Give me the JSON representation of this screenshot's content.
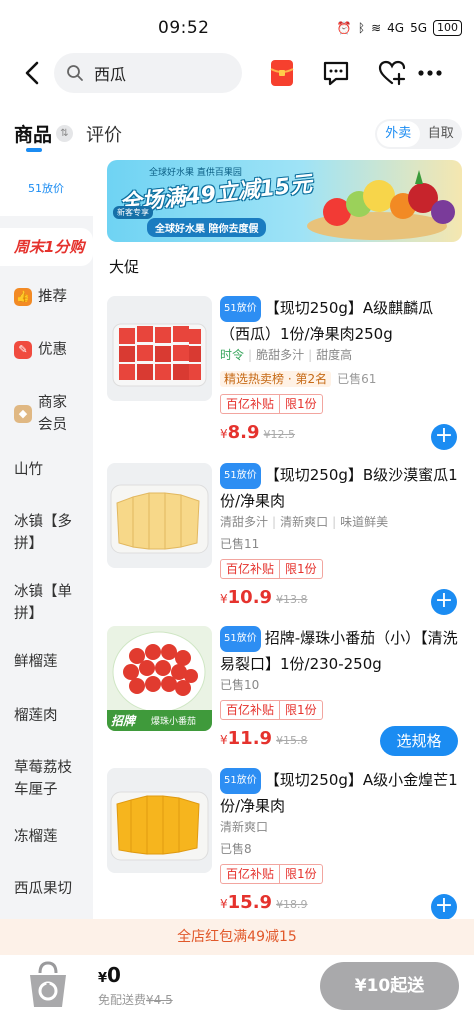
{
  "status_bar": {
    "time": "09:52",
    "signal1": "4G",
    "signal2": "5G",
    "battery": "100"
  },
  "search": {
    "query": "西瓜"
  },
  "tabs": {
    "goods": "商品",
    "review": "评价",
    "delivery": "外卖",
    "pickup": "自取"
  },
  "sidebar": {
    "items": [
      {
        "label": "51放价"
      },
      {
        "label": "周末1分购"
      },
      {
        "label": "推荐"
      },
      {
        "label": "优惠"
      },
      {
        "label": "商家会员"
      },
      {
        "label": "山竹"
      },
      {
        "label": "冰镇【多拼】"
      },
      {
        "label": "冰镇【单拼】"
      },
      {
        "label": "鲜榴莲"
      },
      {
        "label": "榴莲肉"
      },
      {
        "label": "草莓荔枝车厘子"
      },
      {
        "label": "冻榴莲"
      },
      {
        "label": "西瓜果切"
      }
    ]
  },
  "banner": {
    "top_line": "全球好水果 直供百果园",
    "headline": "全场满49立减15元",
    "tag": "新客专享",
    "slogan": "全球好水果 陪你去度假"
  },
  "section_title": "大促",
  "badge": "51放价",
  "products": [
    {
      "name": "【现切250g】A级麒麟瓜（西瓜）1份/净果肉250g",
      "tags": [
        "时令",
        "脆甜多汁",
        "甜度高"
      ],
      "rank": "精选热卖榜 · 第2名",
      "sold": "已售61",
      "chip1": "百亿补贴",
      "chip2": "限1份",
      "yen": "¥",
      "price": "8.9",
      "original": "¥12.5",
      "action": "+"
    },
    {
      "name": "【现切250g】B级沙漠蜜瓜1份/净果肉",
      "tags": [
        "清甜多汁",
        "清新爽口",
        "味道鲜美"
      ],
      "sold": "已售11",
      "chip1": "百亿补贴",
      "chip2": "限1份",
      "yen": "¥",
      "price": "10.9",
      "original": "¥13.8",
      "action": "+"
    },
    {
      "name": "招牌-爆珠小番茄（小）【清洗易裂口】1份/230-250g",
      "sold": "已售10",
      "chip1": "百亿补贴",
      "chip2": "限1份",
      "yen": "¥",
      "price": "11.9",
      "original": "¥15.8",
      "action": "选规格",
      "image_caption": "招牌",
      "image_caption2": "爆珠小番茄"
    },
    {
      "name": "【现切250g】A级小金煌芒1份/净果肉",
      "tags": [
        "清新爽口"
      ],
      "sold": "已售8",
      "chip1": "百亿补贴",
      "chip2": "限1份",
      "yen": "¥",
      "price": "15.9",
      "original": "¥18.9",
      "action": "+"
    }
  ],
  "promo_bar": "全店红包满49减15",
  "bottom": {
    "yen": "¥",
    "total": "0",
    "fee_label": "免配送费",
    "fee_original": "¥4.5",
    "checkout": "¥10起送"
  },
  "colors": {
    "accent": "#1b8cf2",
    "price": "#e5322d",
    "promo_text": "#e1592b",
    "checkout_disabled": "#a9a9ab"
  }
}
